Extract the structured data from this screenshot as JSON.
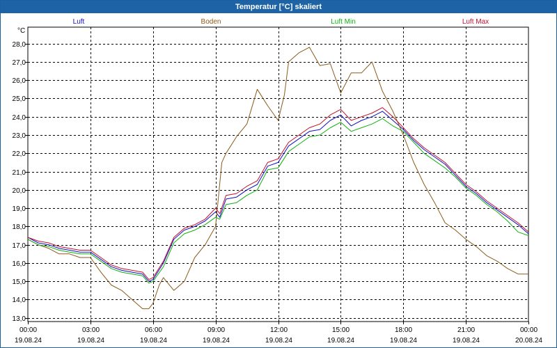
{
  "title": "Temperatur [°C] skaliert",
  "chart_data": {
    "type": "line",
    "title": "Temperatur [°C] skaliert",
    "ylabel": "°C",
    "xlabel": "",
    "ylim": [
      12.8,
      28.9
    ],
    "xlim": [
      0,
      24
    ],
    "grid": true,
    "legend": "top",
    "yticks": [
      "13,0",
      "14,0",
      "15,0",
      "16,0",
      "17,0",
      "18,0",
      "19,0",
      "20,0",
      "21,0",
      "22,0",
      "23,0",
      "24,0",
      "25,0",
      "26,0",
      "27,0",
      "28,0"
    ],
    "xticks": [
      {
        "time": "00:00",
        "date": "19.08.24"
      },
      {
        "time": "03:00",
        "date": "19.08.24"
      },
      {
        "time": "06:00",
        "date": "19.08.24"
      },
      {
        "time": "09:00",
        "date": "19.08.24"
      },
      {
        "time": "12:00",
        "date": "19.08.24"
      },
      {
        "time": "15:00",
        "date": "19.08.24"
      },
      {
        "time": "18:00",
        "date": "19.08.24"
      },
      {
        "time": "21:00",
        "date": "19.08.24"
      },
      {
        "time": "00:00",
        "date": "20.08.24"
      }
    ],
    "series": [
      {
        "name": "Luft",
        "color": "#1010c0",
        "x": [
          0,
          0.5,
          1,
          1.5,
          2,
          2.5,
          3,
          3.5,
          4,
          4.5,
          5,
          5.5,
          5.8,
          6,
          6.5,
          7,
          7.5,
          8,
          8.5,
          9,
          9.2,
          9.5,
          10,
          10.5,
          11,
          11.5,
          12,
          12.5,
          13,
          13.5,
          14,
          14.5,
          15,
          15.5,
          16,
          16.5,
          17,
          17.5,
          18,
          18.5,
          19,
          19.5,
          20,
          20.5,
          21,
          21.5,
          22,
          22.5,
          23,
          23.5,
          24
        ],
        "y": [
          17.4,
          17.1,
          17.0,
          16.8,
          16.7,
          16.6,
          16.6,
          16.2,
          15.8,
          15.6,
          15.5,
          15.4,
          15.0,
          15.1,
          16.0,
          17.3,
          17.8,
          18.0,
          18.3,
          18.8,
          18.5,
          19.5,
          19.6,
          20.0,
          20.3,
          21.3,
          21.5,
          22.4,
          22.8,
          23.2,
          23.3,
          23.8,
          24.1,
          23.5,
          23.8,
          24.0,
          24.3,
          23.8,
          23.3,
          22.7,
          22.2,
          21.8,
          21.4,
          20.8,
          20.2,
          19.8,
          19.3,
          18.9,
          18.5,
          18.1,
          17.6
        ]
      },
      {
        "name": "Boden",
        "color": "#8b5a1a",
        "x": [
          0,
          0.5,
          1,
          1.5,
          2,
          2.5,
          3,
          3.5,
          4,
          4.5,
          5,
          5.5,
          5.8,
          6,
          6.3,
          6.5,
          7,
          7.5,
          8,
          8.5,
          9,
          9.3,
          9.5,
          10,
          10.5,
          11,
          11.5,
          12,
          12.3,
          12.5,
          13,
          13.5,
          14,
          14.5,
          15,
          15.5,
          16,
          16.5,
          17,
          17.5,
          18,
          18.5,
          19,
          19.5,
          20,
          20.5,
          21,
          21.5,
          22,
          22.5,
          23,
          23.5,
          24
        ],
        "y": [
          17.3,
          17.0,
          16.8,
          16.5,
          16.5,
          16.3,
          16.3,
          15.5,
          14.8,
          14.5,
          14.0,
          13.5,
          13.5,
          13.8,
          14.8,
          15.2,
          14.5,
          15.0,
          16.3,
          17.0,
          18.0,
          21.5,
          22.0,
          22.9,
          23.6,
          25.5,
          24.6,
          23.8,
          25.2,
          27.0,
          27.5,
          27.8,
          26.8,
          26.9,
          25.3,
          26.4,
          26.4,
          27.0,
          25.4,
          24.3,
          23.0,
          21.5,
          20.3,
          19.3,
          18.2,
          17.8,
          17.3,
          16.9,
          16.4,
          16.1,
          15.7,
          15.4,
          15.4
        ]
      },
      {
        "name": "Luft Min",
        "color": "#10b010",
        "x": [
          0,
          0.5,
          1,
          1.5,
          2,
          2.5,
          3,
          3.5,
          4,
          4.5,
          5,
          5.5,
          5.8,
          6,
          6.5,
          7,
          7.5,
          8,
          8.5,
          9,
          9.2,
          9.5,
          10,
          10.5,
          11,
          11.5,
          12,
          12.5,
          13,
          13.5,
          14,
          14.5,
          15,
          15.5,
          16,
          16.5,
          17,
          17.5,
          18,
          18.5,
          19,
          19.5,
          20,
          20.5,
          21,
          21.5,
          22,
          22.5,
          23,
          23.5,
          24
        ],
        "y": [
          17.3,
          17.0,
          16.9,
          16.7,
          16.6,
          16.5,
          16.5,
          16.1,
          15.7,
          15.5,
          15.4,
          15.3,
          14.9,
          15.0,
          15.8,
          17.1,
          17.6,
          17.8,
          18.1,
          18.5,
          18.4,
          19.2,
          19.3,
          19.7,
          20.0,
          21.1,
          21.2,
          22.1,
          22.5,
          22.9,
          23.0,
          23.4,
          23.7,
          23.2,
          23.4,
          23.6,
          23.9,
          23.5,
          23.2,
          22.6,
          22.0,
          21.6,
          21.2,
          20.7,
          20.1,
          19.7,
          19.2,
          18.8,
          18.3,
          17.7,
          17.5
        ]
      },
      {
        "name": "Luft Max",
        "color": "#c01030",
        "x": [
          0,
          0.5,
          1,
          1.5,
          2,
          2.5,
          3,
          3.5,
          4,
          4.5,
          5,
          5.5,
          5.8,
          6,
          6.5,
          7,
          7.5,
          8,
          8.5,
          9,
          9.2,
          9.5,
          10,
          10.5,
          11,
          11.5,
          12,
          12.5,
          13,
          13.5,
          14,
          14.5,
          15,
          15.5,
          16,
          16.5,
          17,
          17.5,
          18,
          18.5,
          19,
          19.5,
          20,
          20.5,
          21,
          21.5,
          22,
          22.5,
          23,
          23.5,
          24
        ],
        "y": [
          17.4,
          17.2,
          17.1,
          16.9,
          16.8,
          16.7,
          16.7,
          16.3,
          15.9,
          15.7,
          15.6,
          15.5,
          15.1,
          15.2,
          16.1,
          17.4,
          17.9,
          18.1,
          18.4,
          19.0,
          18.7,
          19.7,
          19.8,
          20.2,
          20.5,
          21.5,
          21.7,
          22.6,
          23.0,
          23.4,
          23.6,
          24.1,
          24.4,
          23.8,
          24.0,
          24.2,
          24.5,
          24.0,
          23.4,
          22.8,
          22.3,
          21.9,
          21.5,
          20.9,
          20.3,
          19.9,
          19.4,
          19.0,
          18.6,
          18.2,
          17.7
        ]
      }
    ]
  }
}
